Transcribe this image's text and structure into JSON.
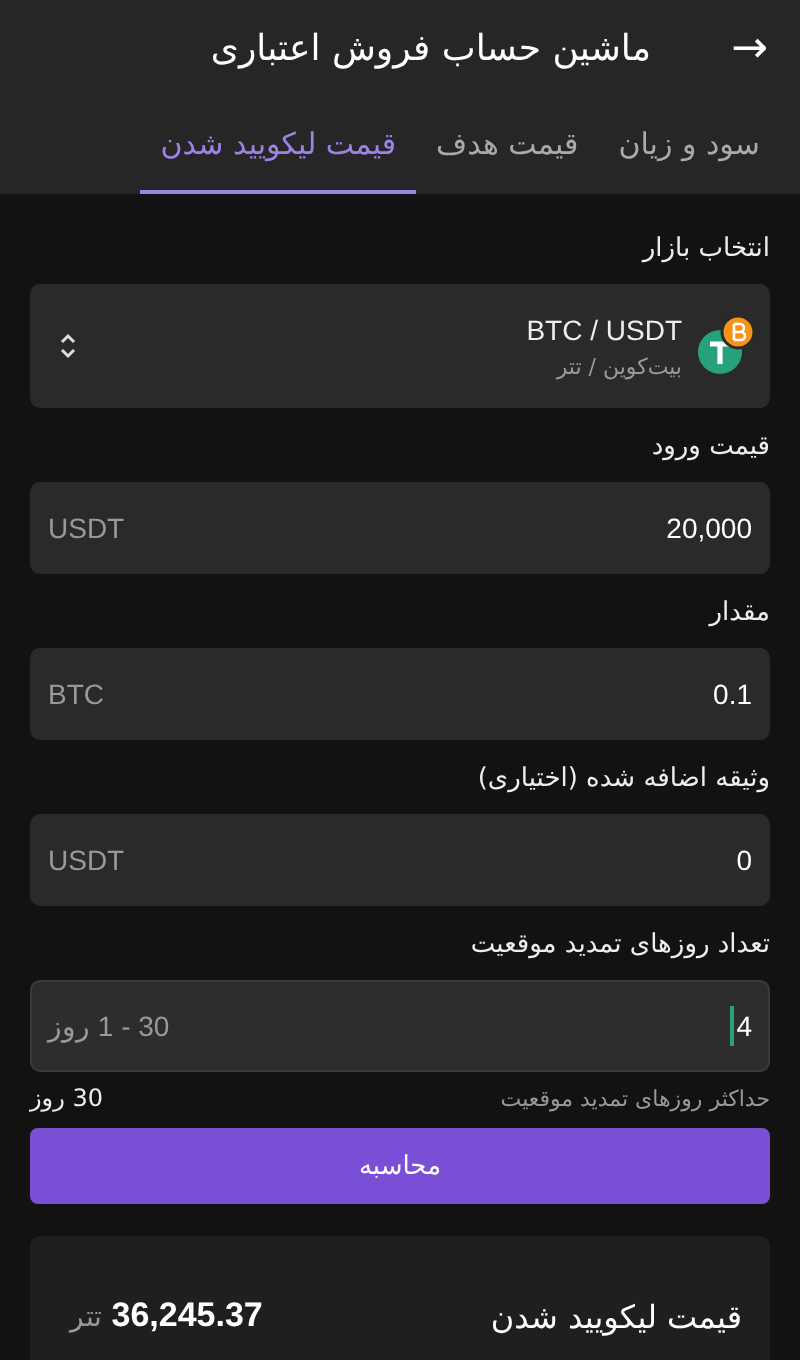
{
  "header": {
    "back": "→",
    "title": "ماشین حساب فروش اعتباری"
  },
  "tabs": [
    {
      "label": "سود و زیان",
      "selected": false
    },
    {
      "label": "قیمت هدف",
      "selected": false
    },
    {
      "label": "قیمت لیکویید شدن",
      "selected": true
    }
  ],
  "market": {
    "label": "انتخاب بازار",
    "pair": "BTC / USDT",
    "names": "بیت‌کوین / تتر"
  },
  "fields": [
    {
      "label": "قیمت ورود",
      "value": "20,000",
      "unit": "USDT",
      "focused": false
    },
    {
      "label": "مقدار",
      "value": "0.1",
      "unit": "BTC",
      "focused": false
    },
    {
      "label": "وثیقه اضافه شده (اختیاری)",
      "value": "0",
      "unit": "USDT",
      "focused": false
    },
    {
      "label": "تعداد روزهای تمدید موقعیت",
      "value": "4",
      "unit": "30 - 1 روز",
      "focused": true
    }
  ],
  "hint": {
    "text": "حداکثر روزهای تمدید موقعیت",
    "value": "30 روز"
  },
  "button": "محاسبه",
  "result": {
    "label": "قیمت لیکویید شدن",
    "value": "36,245.37",
    "unit": "تتر"
  }
}
